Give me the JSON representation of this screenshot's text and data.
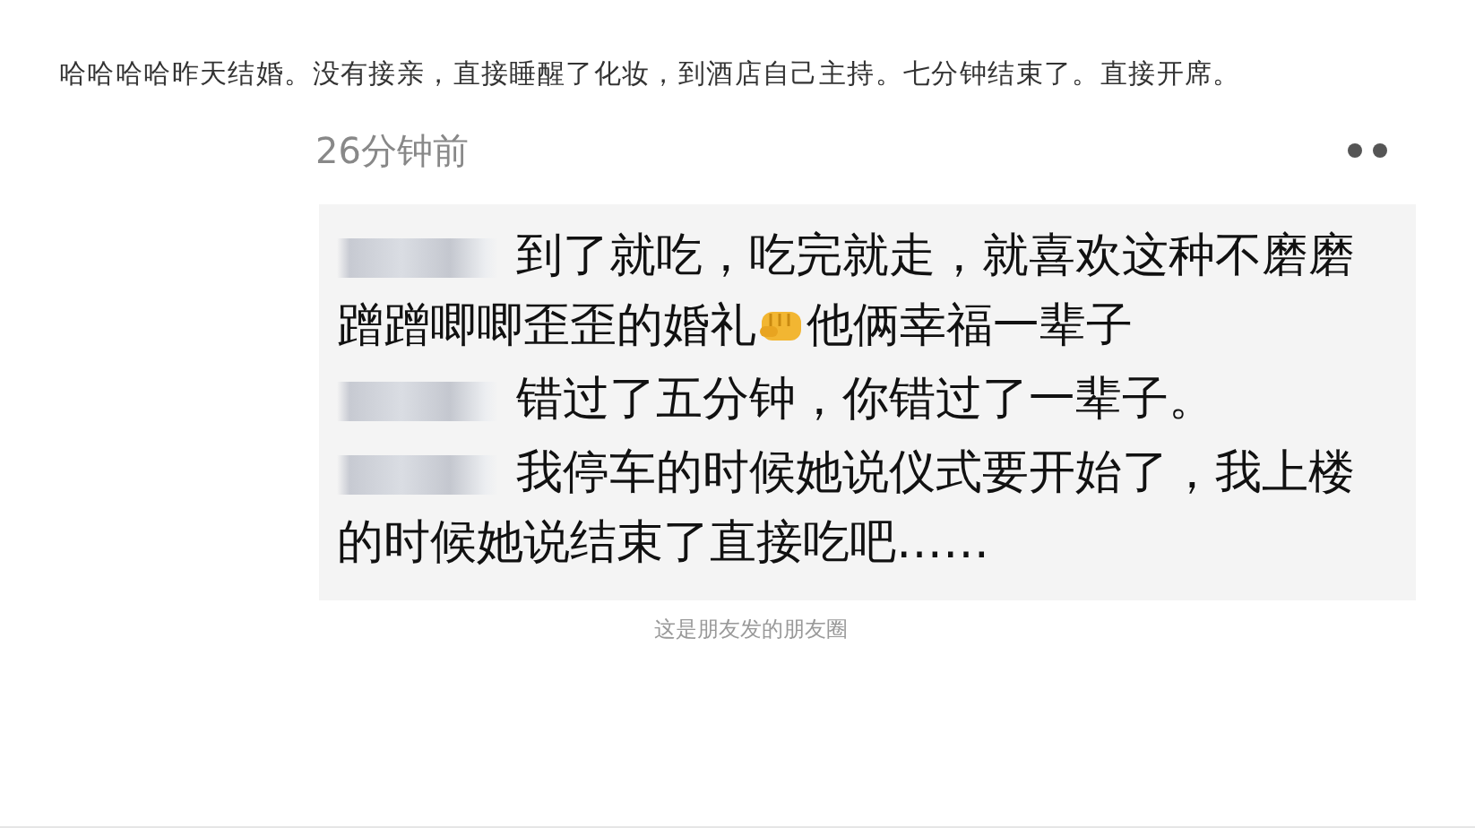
{
  "article": {
    "paragraph": "哈哈哈哈昨天结婚。没有接亲，直接睡醒了化妆，到酒店自己主持。七分钟结束了。直接开席。"
  },
  "screenshot": {
    "time": "26分钟前",
    "comments": [
      {
        "segments": [
          {
            "kind": "text",
            "text": "到了就吃，吃完就走，就喜欢这种不磨磨蹭蹭唧唧歪歪的婚礼"
          },
          {
            "kind": "emoji"
          },
          {
            "kind": "text",
            "text": "他俩幸福一辈子"
          }
        ]
      },
      {
        "segments": [
          {
            "kind": "text",
            "text": "错过了五分钟，你错过了一辈子。"
          }
        ]
      },
      {
        "segments": [
          {
            "kind": "text",
            "text": "我停车的时候她说仪式要开始了，我上楼的时候她说结束了直接吃吧……"
          }
        ]
      }
    ]
  },
  "caption": "这是朋友发的朋友圈"
}
